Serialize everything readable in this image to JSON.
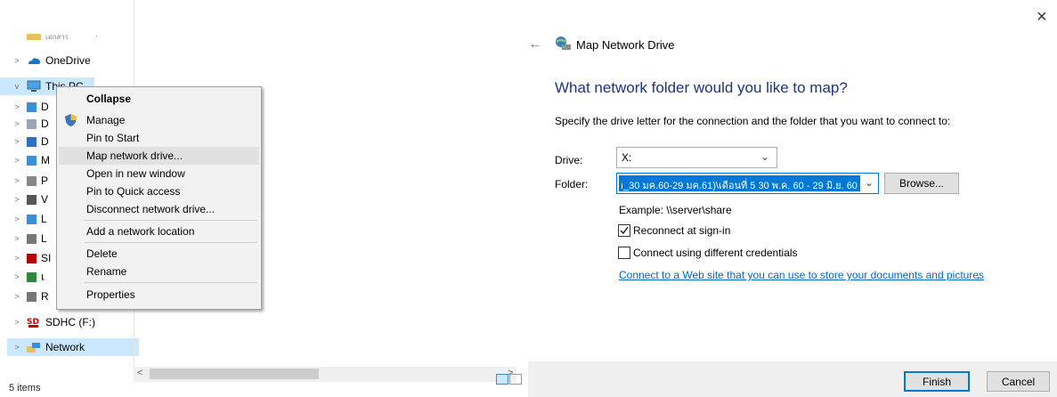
{
  "nav": {
    "top_item": "เอกสาร",
    "onedrive": "OneDrive",
    "this_pc": "This PC",
    "child_letters": [
      "D",
      "D",
      "D",
      "M",
      "P",
      "V",
      "L",
      "L",
      "SI",
      "เ",
      "R"
    ],
    "sdhc": "SDHC (F:)",
    "network": "Network",
    "status": "5 items"
  },
  "context_menu": {
    "items": [
      "Collapse",
      "Manage",
      "Pin to Start",
      "Map network drive...",
      "Open in new window",
      "Pin to Quick access",
      "Disconnect network drive...",
      "Add a network location",
      "Delete",
      "Rename",
      "Properties"
    ]
  },
  "dialog": {
    "title": "Map Network Drive",
    "heading": "What network folder would you like to map?",
    "description": "Specify the drive letter for the connection and the folder that you want to connect to:",
    "drive_label": "Drive:",
    "drive_value": "X:",
    "folder_label": "Folder:",
    "folder_value": "ı_30 มค.60-29 มค.61)\\เดือนที่ 5 30 พ.ค. 60 - 29 มิ.ย. 60",
    "browse": "Browse...",
    "example": "Example: \\\\server\\share",
    "reconnect": "Reconnect at sign-in",
    "reconnect_checked": true,
    "credentials": "Connect using different credentials",
    "credentials_checked": false,
    "link": "Connect to a Web site that you can use to store your documents and pictures",
    "finish": "Finish",
    "cancel": "Cancel",
    "close_glyph": "×",
    "back_glyph": "←",
    "link_period": "."
  }
}
